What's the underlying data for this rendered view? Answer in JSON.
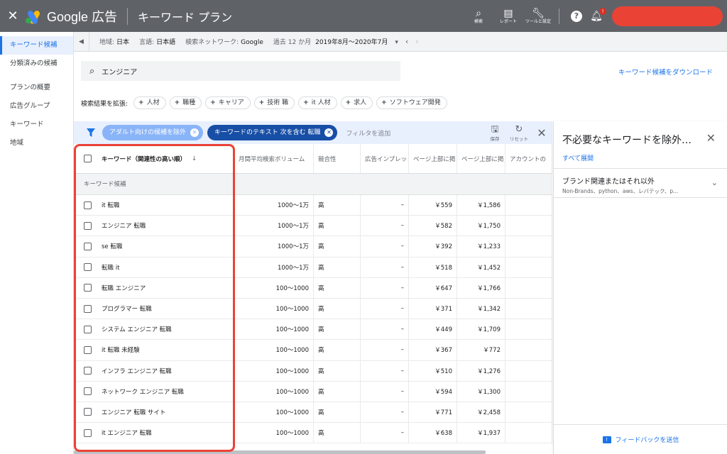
{
  "topbar": {
    "close_icon": "close-icon",
    "app_name": "Google 広告",
    "page_title": "キーワード プラン",
    "buttons": [
      {
        "icon": "search-icon",
        "label": "検索"
      },
      {
        "icon": "report-icon",
        "label": "レポート"
      },
      {
        "icon": "wrench-icon",
        "label": "ツールと設定"
      }
    ],
    "notification_badge": "!"
  },
  "leftnav": {
    "items": [
      {
        "label": "キーワード候補",
        "active": true
      },
      {
        "label": "分類済みの候補"
      },
      {
        "label": "プランの概要"
      },
      {
        "label": "広告グループ"
      },
      {
        "label": "キーワード"
      },
      {
        "label": "地域"
      }
    ]
  },
  "settings": {
    "location_label": "地域:",
    "location_value": "日本",
    "language_label": "言語:",
    "language_value": "日本語",
    "network_label": "検索ネットワーク:",
    "network_value": "Google",
    "period_label": "過去 12 か月",
    "period_value": "2019年8月〜2020年7月"
  },
  "search": {
    "value": "エンジニア",
    "download_link": "キーワード候補をダウンロード"
  },
  "expand": {
    "label": "検索結果を拡張:",
    "chips": [
      "人材",
      "職種",
      "キャリア",
      "技術 職",
      "it 人材",
      "求人",
      "ソフトウェア開発"
    ]
  },
  "filters": {
    "chips": [
      "アダルト向けの候補を除外",
      "キーワードのテキスト 次を含む 転職"
    ],
    "add_filter": "フィルタを追加",
    "save_label": "保存",
    "reset_label": "リセット"
  },
  "table": {
    "headers": [
      "キーワード（関連性の高い順）",
      "月間平均検索ボリューム",
      "競合性",
      "広告インプレッ",
      "ページ上部に掲",
      "ページ上部に掲",
      "アカウントの"
    ],
    "group_label": "キーワード候補",
    "rows": [
      [
        "it 転職",
        "1000〜1万",
        "高",
        "–",
        "￥559",
        "￥1,586"
      ],
      [
        "エンジニア 転職",
        "1000〜1万",
        "高",
        "–",
        "￥582",
        "￥1,750"
      ],
      [
        "se 転職",
        "1000〜1万",
        "高",
        "–",
        "￥392",
        "￥1,233"
      ],
      [
        "転職 it",
        "1000〜1万",
        "高",
        "–",
        "￥518",
        "￥1,452"
      ],
      [
        "転職 エンジニア",
        "100〜1000",
        "高",
        "–",
        "￥647",
        "￥1,766"
      ],
      [
        "プログラマー 転職",
        "100〜1000",
        "高",
        "–",
        "￥371",
        "￥1,342"
      ],
      [
        "システム エンジニア 転職",
        "100〜1000",
        "高",
        "–",
        "￥449",
        "￥1,709"
      ],
      [
        "it 転職 未経験",
        "100〜1000",
        "高",
        "–",
        "￥367",
        "￥772"
      ],
      [
        "インフラ エンジニア 転職",
        "100〜1000",
        "高",
        "–",
        "￥510",
        "￥1,276"
      ],
      [
        "ネットワーク エンジニア 転職",
        "100〜1000",
        "高",
        "–",
        "￥594",
        "￥1,300"
      ],
      [
        "エンジニア 転職 サイト",
        "100〜1000",
        "高",
        "–",
        "￥771",
        "￥2,458"
      ],
      [
        "it エンジニア 転職",
        "100〜1000",
        "高",
        "–",
        "￥638",
        "￥1,937"
      ]
    ]
  },
  "rightpanel": {
    "title": "不必要なキーワードを除外…",
    "expand_all": "すべて展開",
    "section_title": "ブランド関連またはそれ以外",
    "section_subtitle": "Non-Brands、python、aws、レバテック、p...",
    "feedback": "フィードバックを送信"
  }
}
